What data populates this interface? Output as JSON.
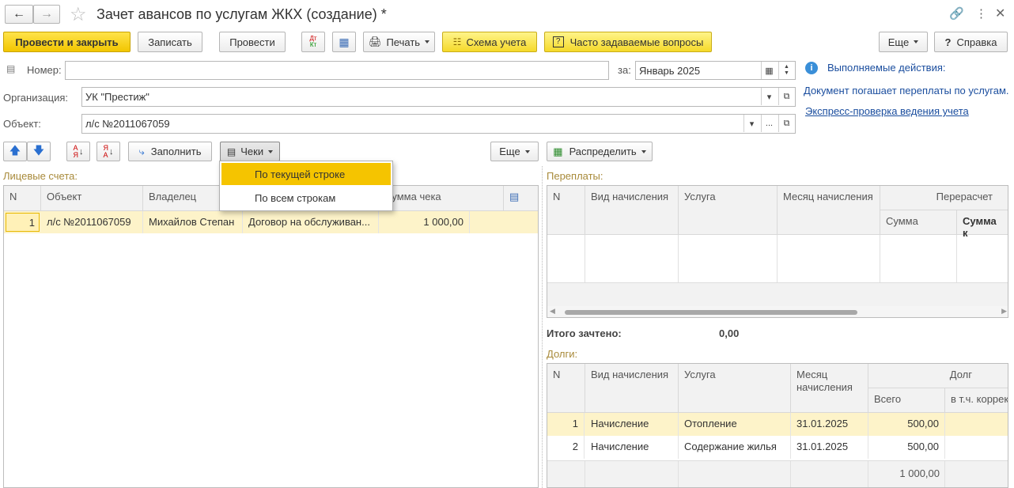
{
  "window": {
    "title": "Зачет авансов по услугам ЖКХ (создание) *"
  },
  "toolbar": {
    "post_close": "Провести и закрыть",
    "save": "Записать",
    "post": "Провести",
    "dtkt": "Дт Кт",
    "print": "Печать",
    "scheme": "Схема учета",
    "faq": "Часто задаваемые вопросы",
    "more": "Еще",
    "help": "Справка"
  },
  "form": {
    "number_label": "Номер:",
    "number_value": "",
    "date_label": "за:",
    "date_value": "Январь 2025",
    "org_label": "Организация:",
    "org_value": "УК \"Престиж\"",
    "object_label": "Объект:",
    "object_value": "л/с №2011067059"
  },
  "info": {
    "title": "Выполняемые действия:",
    "desc": "Документ погашает переплаты по услугам.",
    "link": "Экспресс-проверка ведения учета"
  },
  "left_toolbar": {
    "fill": "Заполнить",
    "checks": "Чеки",
    "more": "Еще"
  },
  "checks_menu": {
    "item1": "По текущей строке",
    "item2": "По всем строкам"
  },
  "accounts": {
    "title": "Лицевые счета:",
    "headers": {
      "n": "N",
      "object": "Объект",
      "owner": "Владелец",
      "sum": "Сумма чека"
    },
    "rows": [
      {
        "n": "1",
        "object": "л/с №2011067059",
        "owner": "Михайлов Степан",
        "contract": "Договор на обслуживан...",
        "sum": "1 000,00"
      }
    ]
  },
  "right_toolbar": {
    "distribute": "Распределить"
  },
  "overpay": {
    "title": "Переплаты:",
    "headers": {
      "n": "N",
      "type": "Вид начисления",
      "service": "Услуга",
      "month": "Месяц начисления",
      "recalc": "Перерасчет",
      "sum": "Сумма",
      "sum_k": "Сумма к"
    }
  },
  "total": {
    "label": "Итого зачтено:",
    "value": "0,00"
  },
  "debts": {
    "title": "Долги:",
    "headers": {
      "n": "N",
      "type": "Вид начисления",
      "service": "Услуга",
      "month": "Месяц начисления",
      "debt": "Долг",
      "all": "Всего",
      "corr": "в т.ч. коррек"
    },
    "rows": [
      {
        "n": "1",
        "type": "Начисление",
        "service": "Отопление",
        "month": "31.01.2025",
        "all": "500,00"
      },
      {
        "n": "2",
        "type": "Начисление",
        "service": "Содержание жилья",
        "month": "31.01.2025",
        "all": "500,00"
      }
    ],
    "footer_total": "1 000,00"
  },
  "colors": {
    "accent": "#f5d92a",
    "selected_row": "#fdf3c9",
    "section_title": "#a88a3a",
    "link": "#1a4d9e"
  }
}
